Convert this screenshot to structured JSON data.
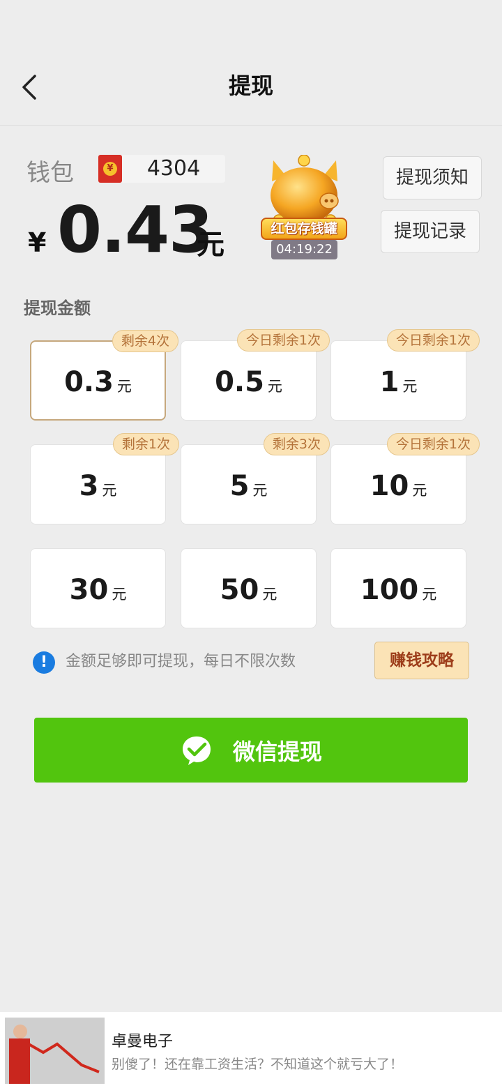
{
  "header": {
    "title": "提现"
  },
  "wallet": {
    "label": "钱包",
    "coins": "4304",
    "currency_symbol": "¥",
    "balance": "0.43",
    "unit": "元"
  },
  "piggy_bank": {
    "label": "红包存钱罐",
    "timer": "04:19:22"
  },
  "buttons": {
    "notice": "提现须知",
    "records": "提现记录"
  },
  "amount_section": {
    "label": "提现金额",
    "unit": "元",
    "options": [
      {
        "value": "0.3",
        "badge": "剩余4次",
        "selected": true
      },
      {
        "value": "0.5",
        "badge": "今日剩余1次"
      },
      {
        "value": "1",
        "badge": "今日剩余1次"
      },
      {
        "value": "3",
        "badge": "剩余1次"
      },
      {
        "value": "5",
        "badge": "剩余3次"
      },
      {
        "value": "10",
        "badge": "今日剩余1次"
      },
      {
        "value": "30",
        "badge": ""
      },
      {
        "value": "50",
        "badge": ""
      },
      {
        "value": "100",
        "badge": ""
      }
    ]
  },
  "info": {
    "icon": "!",
    "text": "金额足够即可提现，每日不限次数",
    "strategy_button": "赚钱攻略"
  },
  "withdraw": {
    "label": "微信提现",
    "icon": "wechat-icon",
    "color": "#52c50e"
  },
  "ad": {
    "title": "卓曼电子",
    "description": "别傻了！还在靠工资生活？不知道这个就亏大了！"
  },
  "colors": {
    "accent_green": "#52c50e",
    "badge_bg": "#fbe3b6",
    "badge_text": "#b4733a",
    "info_blue": "#1a7ce0"
  }
}
